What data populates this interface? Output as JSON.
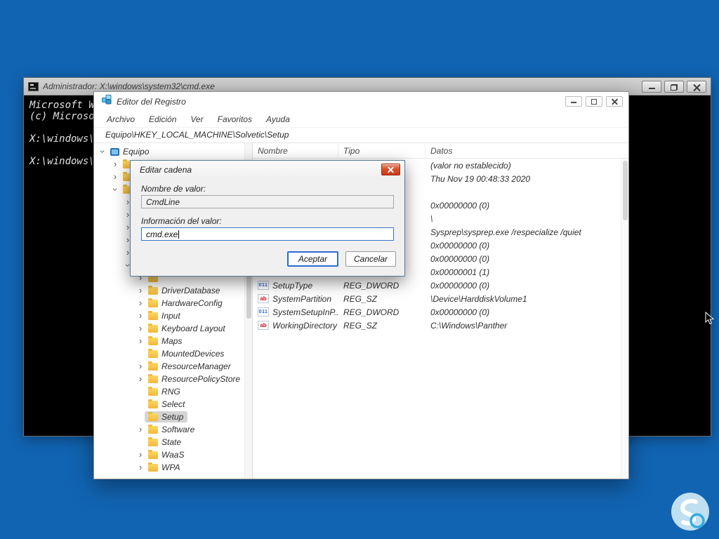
{
  "colors": {
    "desktop": "#1164b2",
    "selection_grey": "#d4d4d4",
    "focus_blue": "#2b6cd4",
    "close_red": "#d9502c",
    "folder_yellow": "#f2b73e"
  },
  "icons": {
    "chevron": "›",
    "string_value": "ab",
    "dword_value": "011"
  },
  "cmd_window": {
    "title": "Administrador: X:\\windows\\system32\\cmd.exe",
    "lines": [
      "Microsoft W",
      "(c) Microso",
      "",
      "X:\\windows\\s",
      "",
      "X:\\windows\\s"
    ]
  },
  "registry_window": {
    "title": "Editor del Registro",
    "menu": [
      "Archivo",
      "Edición",
      "Ver",
      "Favoritos",
      "Ayuda"
    ],
    "address": "Equipo\\HKEY_LOCAL_MACHINE\\Solvetic\\Setup",
    "tree": {
      "items": [
        {
          "label": "Equipo",
          "depth": 0,
          "chevron": "d",
          "icon": "pc",
          "selected": false
        },
        {
          "label": "",
          "depth": 1,
          "chevron": "r",
          "icon": "folder",
          "selected": false
        },
        {
          "label": "",
          "depth": 1,
          "chevron": "r",
          "icon": "folder",
          "selected": false
        },
        {
          "label": "",
          "depth": 1,
          "chevron": "d",
          "icon": "folder",
          "selected": false
        },
        {
          "label": "",
          "depth": 2,
          "chevron": "r",
          "icon": "folder",
          "selected": false
        },
        {
          "label": "",
          "depth": 2,
          "chevron": "r",
          "icon": "folder",
          "selected": false
        },
        {
          "label": "",
          "depth": 2,
          "chevron": "r",
          "icon": "folder",
          "selected": false
        },
        {
          "label": "",
          "depth": 2,
          "chevron": "r",
          "icon": "folder",
          "selected": false
        },
        {
          "label": "",
          "depth": 2,
          "chevron": "r",
          "icon": "folder",
          "selected": false
        },
        {
          "label": "",
          "depth": 2,
          "chevron": "d",
          "icon": "folder",
          "selected": false
        },
        {
          "label": "",
          "depth": 3,
          "chevron": "r",
          "icon": "folder",
          "selected": false
        },
        {
          "label": "DriverDatabase",
          "depth": 3,
          "chevron": "r",
          "icon": "folder",
          "selected": false
        },
        {
          "label": "HardwareConfig",
          "depth": 3,
          "chevron": "r",
          "icon": "folder",
          "selected": false
        },
        {
          "label": "Input",
          "depth": 3,
          "chevron": "r",
          "icon": "folder",
          "selected": false
        },
        {
          "label": "Keyboard Layout",
          "depth": 3,
          "chevron": "r",
          "icon": "folder",
          "selected": false
        },
        {
          "label": "Maps",
          "depth": 3,
          "chevron": "r",
          "icon": "folder",
          "selected": false
        },
        {
          "label": "MountedDevices",
          "depth": 3,
          "chevron": "none",
          "icon": "folder",
          "selected": false
        },
        {
          "label": "ResourceManager",
          "depth": 3,
          "chevron": "r",
          "icon": "folder",
          "selected": false
        },
        {
          "label": "ResourcePolicyStore",
          "depth": 3,
          "chevron": "r",
          "icon": "folder",
          "selected": false
        },
        {
          "label": "RNG",
          "depth": 3,
          "chevron": "none",
          "icon": "folder",
          "selected": false
        },
        {
          "label": "Select",
          "depth": 3,
          "chevron": "none",
          "icon": "folder",
          "selected": false
        },
        {
          "label": "Setup",
          "depth": 3,
          "chevron": "none",
          "icon": "folder",
          "selected": true
        },
        {
          "label": "Software",
          "depth": 3,
          "chevron": "r",
          "icon": "folder",
          "selected": false
        },
        {
          "label": "State",
          "depth": 3,
          "chevron": "none",
          "icon": "folder",
          "selected": false
        },
        {
          "label": "WaaS",
          "depth": 3,
          "chevron": "r",
          "icon": "folder",
          "selected": false
        },
        {
          "label": "WPA",
          "depth": 3,
          "chevron": "r",
          "icon": "folder",
          "selected": false
        }
      ]
    },
    "list": {
      "columns": [
        "Nombre",
        "Tipo",
        "Datos"
      ],
      "rows": [
        {
          "name": "",
          "type": "",
          "datos": "(valor no establecido)",
          "icon": ""
        },
        {
          "name": "",
          "type": "",
          "datos": "Thu Nov 19 00:48:33 2020",
          "icon": ""
        },
        {
          "name": "",
          "type": "",
          "datos": "",
          "icon": ""
        },
        {
          "name": "",
          "type": "",
          "datos": "0x00000000 (0)",
          "icon": ""
        },
        {
          "name": "",
          "type": "",
          "datos": "\\",
          "icon": ""
        },
        {
          "name": "",
          "type": "",
          "datos": "Sysprep\\sysprep.exe /respecialize /quiet",
          "icon": ""
        },
        {
          "name": "",
          "type": "",
          "datos": "0x00000000 (0)",
          "icon": ""
        },
        {
          "name": "",
          "type": "",
          "datos": "0x00000000 (0)",
          "icon": ""
        },
        {
          "name": "",
          "type": "",
          "datos": "0x00000001 (1)",
          "icon": ""
        },
        {
          "name": "SetupType",
          "type": "REG_DWORD",
          "datos": "0x00000000 (0)",
          "icon": "dword"
        },
        {
          "name": "SystemPartition",
          "type": "REG_SZ",
          "datos": "\\Device\\HarddiskVolume1",
          "icon": "ab"
        },
        {
          "name": "SystemSetupInP...",
          "type": "REG_DWORD",
          "datos": "0x00000000 (0)",
          "icon": "dword"
        },
        {
          "name": "WorkingDirectory",
          "type": "REG_SZ",
          "datos": "C:\\Windows\\Panther",
          "icon": "ab"
        }
      ]
    }
  },
  "dialog": {
    "title": "Editar cadena",
    "value_name_label": "Nombre de valor:",
    "value_name": "CmdLine",
    "value_data_label": "Información del valor:",
    "value_data": "cmd.exe",
    "ok_label": "Aceptar",
    "cancel_label": "Cancelar"
  }
}
